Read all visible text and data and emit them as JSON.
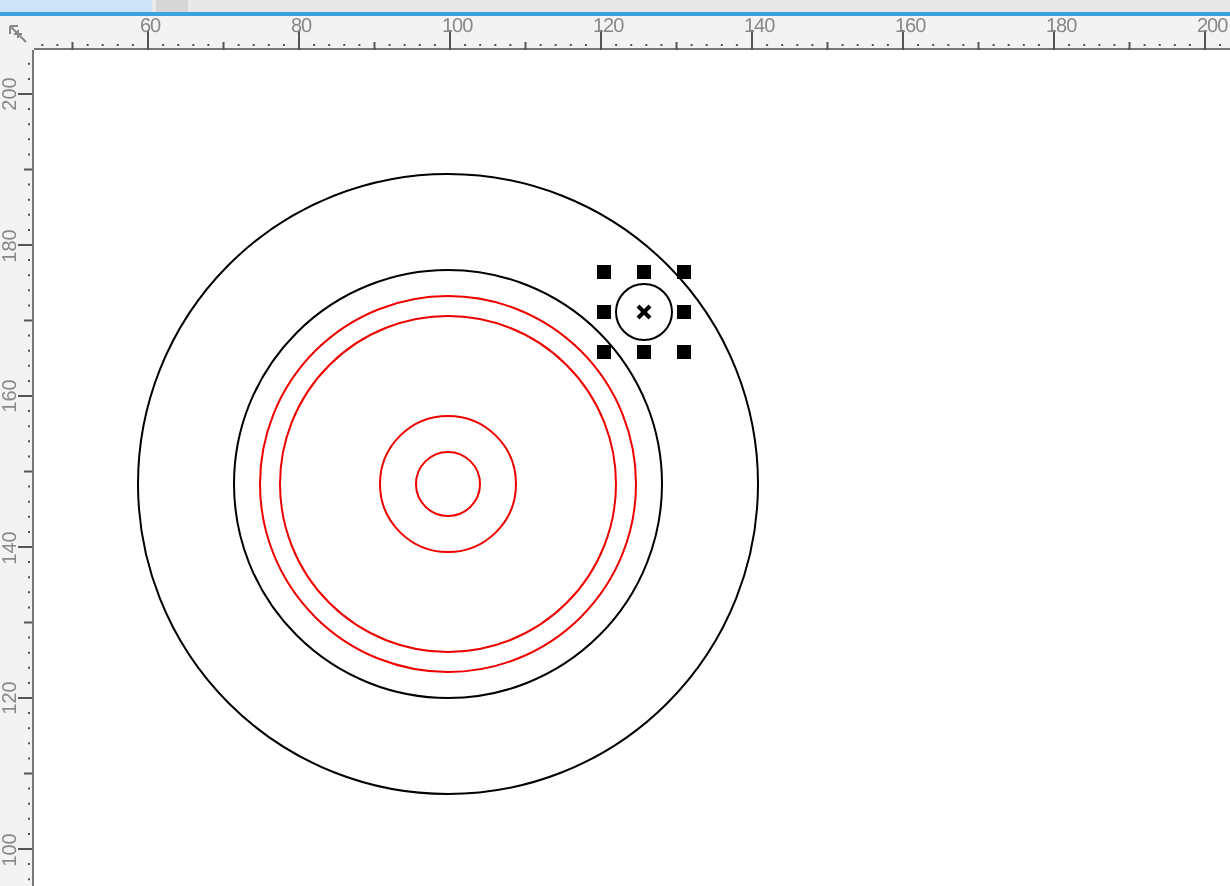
{
  "tabs": [
    {
      "selected": true
    },
    {
      "selected": false
    }
  ],
  "horizontal_ruler": {
    "labels": [
      "60",
      "80",
      "100",
      "120",
      "140",
      "160",
      "180",
      "200"
    ]
  },
  "vertical_ruler": {
    "labels": [
      "200",
      "180",
      "160",
      "140",
      "120",
      "100"
    ]
  }
}
